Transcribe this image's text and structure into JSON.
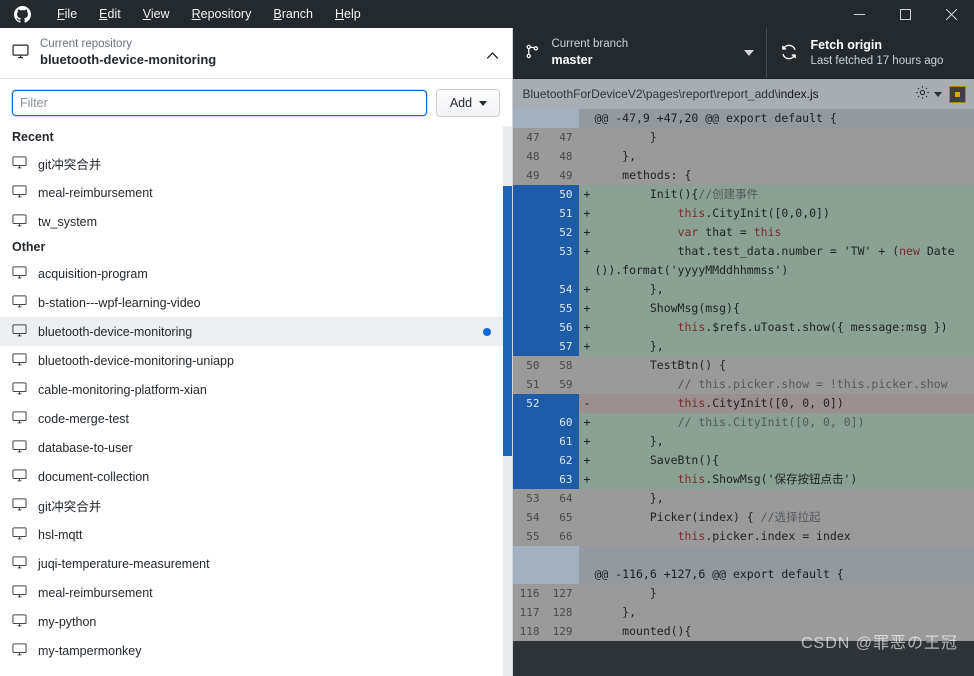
{
  "titlebar": {
    "logo_icon": "github-mark-icon",
    "menus": [
      {
        "label": "File",
        "accel": "F"
      },
      {
        "label": "Edit",
        "accel": "E"
      },
      {
        "label": "View",
        "accel": "V"
      },
      {
        "label": "Repository",
        "accel": "R"
      },
      {
        "label": "Branch",
        "accel": "B"
      },
      {
        "label": "Help",
        "accel": "H"
      }
    ],
    "window_controls": {
      "minimize": "—",
      "maximize": "□",
      "close": "✕"
    }
  },
  "repo_dropdown": {
    "header": {
      "caption": "Current repository",
      "name": "bluetooth-device-monitoring",
      "icon": "repository-monitor-icon",
      "chevron": "chevron-up-icon"
    },
    "filter": {
      "placeholder": "Filter",
      "value": ""
    },
    "add_button": {
      "label": "Add",
      "caret_icon": "chevron-down-icon"
    },
    "groups": [
      {
        "title": "Recent",
        "items": [
          {
            "name": "git冲突合并",
            "selected": false,
            "has_dot": false
          },
          {
            "name": "meal-reimbursement",
            "selected": false,
            "has_dot": false
          },
          {
            "name": "tw_system",
            "selected": false,
            "has_dot": false
          }
        ]
      },
      {
        "title": "Other",
        "items": [
          {
            "name": "acquisition-program",
            "selected": false,
            "has_dot": false
          },
          {
            "name": "b-station---wpf-learning-video",
            "selected": false,
            "has_dot": false
          },
          {
            "name": "bluetooth-device-monitoring",
            "selected": true,
            "has_dot": true
          },
          {
            "name": "bluetooth-device-monitoring-uniapp",
            "selected": false,
            "has_dot": false
          },
          {
            "name": "cable-monitoring-platform-xian",
            "selected": false,
            "has_dot": false
          },
          {
            "name": "code-merge-test",
            "selected": false,
            "has_dot": false
          },
          {
            "name": "database-to-user",
            "selected": false,
            "has_dot": false
          },
          {
            "name": "document-collection",
            "selected": false,
            "has_dot": false
          },
          {
            "name": "git冲突合并",
            "selected": false,
            "has_dot": false
          },
          {
            "name": "hsl-mqtt",
            "selected": false,
            "has_dot": false
          },
          {
            "name": "juqi-temperature-measurement",
            "selected": false,
            "has_dot": false
          },
          {
            "name": "meal-reimbursement",
            "selected": false,
            "has_dot": false
          },
          {
            "name": "my-python",
            "selected": false,
            "has_dot": false
          },
          {
            "name": "my-tampermonkey",
            "selected": false,
            "has_dot": false
          }
        ]
      }
    ]
  },
  "toolbar": {
    "branch": {
      "caption": "Current branch",
      "name": "master",
      "icon": "branch-icon",
      "chevron": "chevron-down-icon"
    },
    "fetch": {
      "title": "Fetch origin",
      "subtitle": "Last fetched 17 hours ago",
      "icon": "sync-refresh-icon"
    }
  },
  "file_bar": {
    "path_prefix": "BluetoothForDeviceV2\\pages\\report\\report_add\\",
    "path_file": "index.js",
    "gear_icon": "gear-icon",
    "gear_caret_icon": "chevron-down-icon",
    "stage_toggle_icon": "partial-stage-checkbox-icon"
  },
  "diff": {
    "lines": [
      {
        "type": "hunk",
        "old": "",
        "new": "",
        "marker": "",
        "code": "@@ -47,9 +47,20 @@ export default {"
      },
      {
        "type": "ctx",
        "old": "47",
        "new": "47",
        "marker": "",
        "code": "        }"
      },
      {
        "type": "ctx",
        "old": "48",
        "new": "48",
        "marker": "",
        "code": "    },"
      },
      {
        "type": "ctx",
        "old": "49",
        "new": "49",
        "marker": "",
        "code": "    methods: {"
      },
      {
        "type": "add",
        "old": "",
        "new": "50",
        "marker": "+",
        "code": "        Init(){//创建事件"
      },
      {
        "type": "add",
        "old": "",
        "new": "51",
        "marker": "+",
        "code": "            this.CityInit([0,0,0])"
      },
      {
        "type": "add",
        "old": "",
        "new": "52",
        "marker": "+",
        "code": "            var that = this"
      },
      {
        "type": "add",
        "old": "",
        "new": "53",
        "marker": "+",
        "code": "            that.test_data.number = 'TW' + (new Date()).format('yyyyMMddhhmmss')"
      },
      {
        "type": "add",
        "old": "",
        "new": "54",
        "marker": "+",
        "code": "        },"
      },
      {
        "type": "add",
        "old": "",
        "new": "55",
        "marker": "+",
        "code": "        ShowMsg(msg){"
      },
      {
        "type": "add",
        "old": "",
        "new": "56",
        "marker": "+",
        "code": "            this.$refs.uToast.show({ message:msg })"
      },
      {
        "type": "add",
        "old": "",
        "new": "57",
        "marker": "+",
        "code": "        },"
      },
      {
        "type": "ctx",
        "old": "50",
        "new": "58",
        "marker": "",
        "code": "        TestBtn() {"
      },
      {
        "type": "ctx",
        "old": "51",
        "new": "59",
        "marker": "",
        "code": "            // this.picker.show = !this.picker.show"
      },
      {
        "type": "del",
        "old": "52",
        "new": "",
        "marker": "-",
        "code": "            this.CityInit([0, 0, 0])"
      },
      {
        "type": "add",
        "old": "",
        "new": "60",
        "marker": "+",
        "code": "            // this.CityInit([0, 0, 0])"
      },
      {
        "type": "add",
        "old": "",
        "new": "61",
        "marker": "+",
        "code": "        },"
      },
      {
        "type": "add",
        "old": "",
        "new": "62",
        "marker": "+",
        "code": "        SaveBtn(){"
      },
      {
        "type": "add",
        "old": "",
        "new": "63",
        "marker": "+",
        "code": "            this.ShowMsg('保存按钮点击')"
      },
      {
        "type": "ctx",
        "old": "53",
        "new": "64",
        "marker": "",
        "code": "        },"
      },
      {
        "type": "ctx",
        "old": "54",
        "new": "65",
        "marker": "",
        "code": "        Picker(index) { //选择拉起"
      },
      {
        "type": "ctx",
        "old": "55",
        "new": "66",
        "marker": "",
        "code": "            this.picker.index = index"
      },
      {
        "type": "blankrow",
        "old": "",
        "new": "",
        "marker": "",
        "code": ""
      },
      {
        "type": "hunk",
        "old": "",
        "new": "",
        "marker": "",
        "code": "@@ -116,6 +127,6 @@ export default {"
      },
      {
        "type": "ctx",
        "old": "116",
        "new": "127",
        "marker": "",
        "code": "        }"
      },
      {
        "type": "ctx",
        "old": "117",
        "new": "128",
        "marker": "",
        "code": "    },"
      },
      {
        "type": "ctx",
        "old": "118",
        "new": "129",
        "marker": "",
        "code": "    mounted(){"
      }
    ]
  },
  "watermark": {
    "text": "CSDN @罪恶の王冠"
  },
  "colors": {
    "titlebar_bg": "#24292e",
    "accent_blue": "#0366d6",
    "gutter_selected": "#1f5ca8",
    "added_bg": "#8ba194",
    "deleted_bg": "#9b8f90",
    "context_bg": "#9a9a9a",
    "hunk_bg": "#93999e",
    "selected_row_bg": "#eceff1",
    "dot_blue": "#0969da",
    "stage_toggle_border": "#b08800"
  }
}
